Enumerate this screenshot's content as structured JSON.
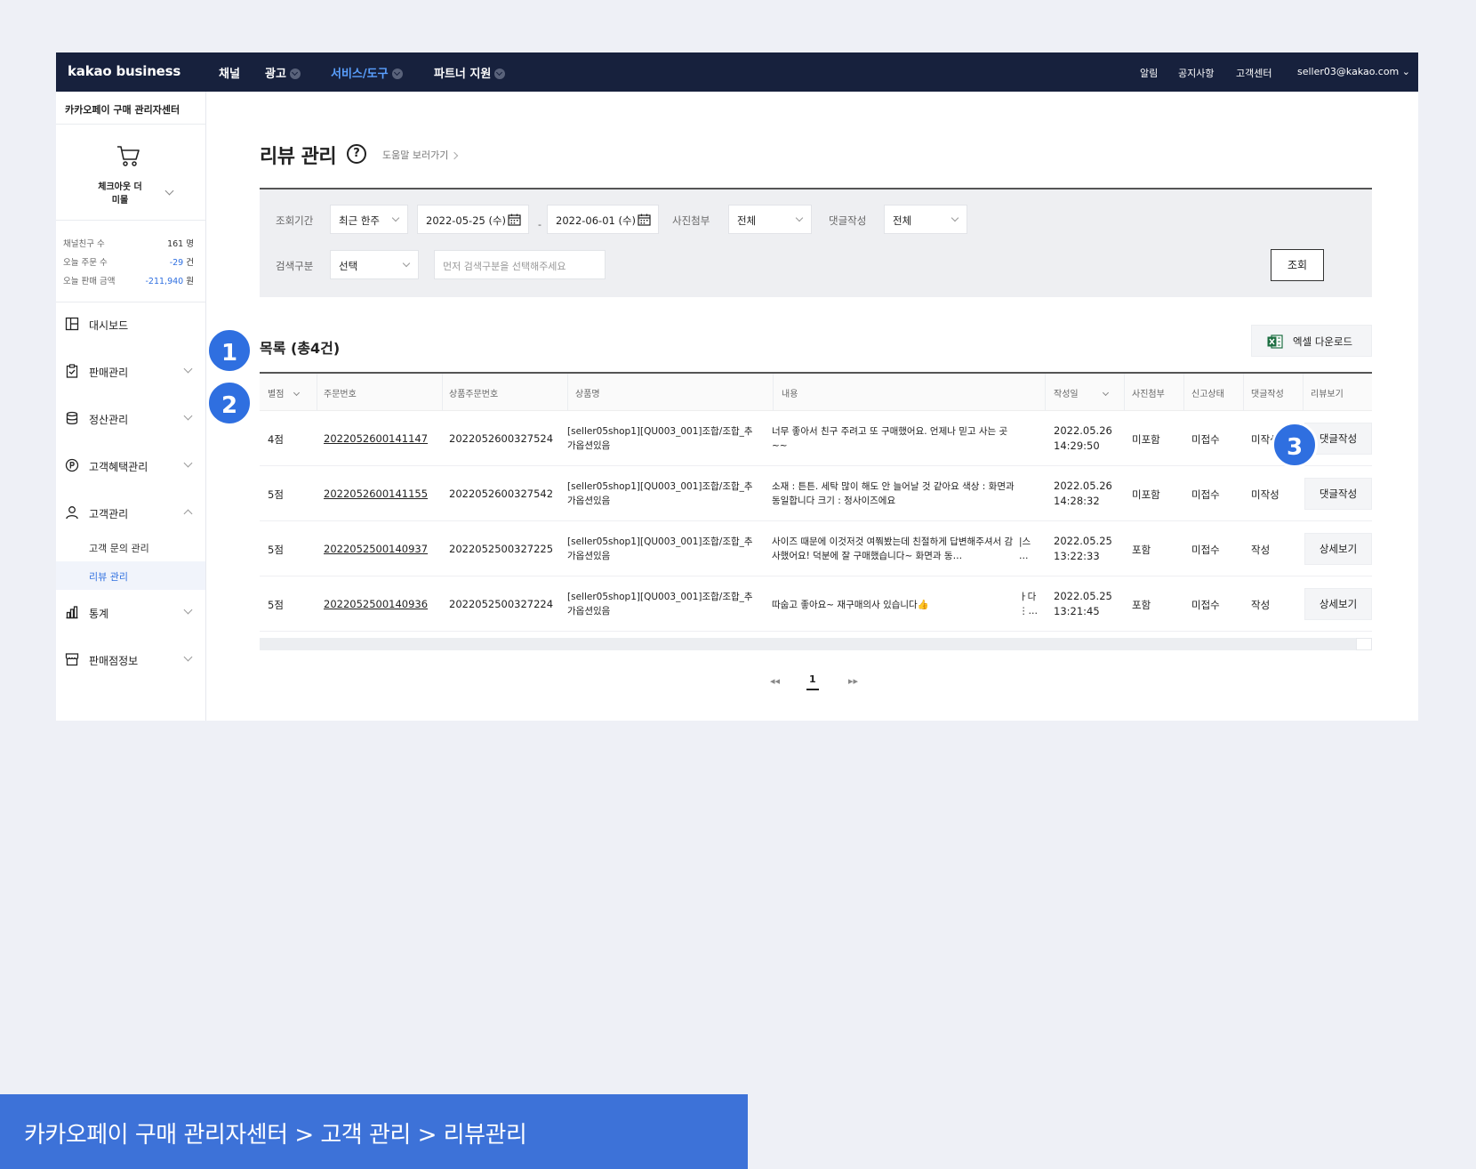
{
  "topnav": {
    "logo": "kakao business",
    "menu": [
      {
        "label": "채널"
      },
      {
        "label": "광고"
      },
      {
        "label": "서비스/도구"
      },
      {
        "label": "파트너 지원"
      }
    ],
    "utils": [
      "알림",
      "공지사항",
      "고객센터",
      "seller03@kakao.com ⌄"
    ]
  },
  "sidebar": {
    "store_title": "카카오페이 구매 관리자센터",
    "shop_name": "체크아웃 더미몰",
    "stats": [
      {
        "label": "채널친구 수",
        "value": "161",
        "unit": "명"
      },
      {
        "label": "오늘 주문 수",
        "value": "-29",
        "unit": "건"
      },
      {
        "label": "오늘 판매 금액",
        "value": "-211,940",
        "unit": "원"
      }
    ],
    "nav": [
      {
        "label": "대시보드"
      },
      {
        "label": "판매관리"
      },
      {
        "label": "정산관리"
      },
      {
        "label": "고객혜택관리"
      },
      {
        "label": "고객관리"
      },
      {
        "label": "통계"
      },
      {
        "label": "판매점정보"
      }
    ],
    "sub": [
      {
        "label": "고객 문의 관리"
      },
      {
        "label": "리뷰 관리"
      }
    ]
  },
  "page": {
    "title": "리뷰 관리",
    "help_icon_glyph": "?",
    "help_link": "도움말 보러가기"
  },
  "filter": {
    "period_label": "조회기간",
    "period_value": "최근 한주",
    "start_date": "2022-05-25 (수)",
    "date_sep": "-",
    "end_date": "2022-06-01 (수)",
    "photo_label": "사진첨부",
    "photo_value": "전체",
    "reply_label": "댓글작성",
    "reply_value": "전체",
    "search_type_label": "검색구분",
    "search_type_value": "선택",
    "search_placeholder": "먼저 검색구분을 선택해주세요",
    "search_button": "조회"
  },
  "list": {
    "title": "목록 (총4건)",
    "excel_button": "엑셀 다운로드",
    "columns": [
      "별점",
      "주문번호",
      "상품주문번호",
      "상품명",
      "내용",
      "작성일",
      "사진첨부",
      "신고상태",
      "댓글작성",
      "리뷰보기"
    ],
    "rows": [
      {
        "rating": "4점",
        "order_no": "2022052600141147",
        "product_order_no": "2022052600327524",
        "product": "[seller05shop1][QU003_001]조합/조합_추가옵션있음",
        "content": "너무 좋아서 친구 주려고 또 구매했어요. 언제나 믿고 사는 곳~~",
        "date": "2022.05.26",
        "time": "14:29:50",
        "photo": "미포함",
        "report": "미접수",
        "reply": "미작성",
        "action": "댓글작성"
      },
      {
        "rating": "5점",
        "order_no": "2022052600141155",
        "product_order_no": "2022052600327542",
        "product": "[seller05shop1][QU003_001]조합/조합_추가옵션있음",
        "content": "소재 : 튼튼. 세탁 많이 해도 안 늘어날 것 같아요 색상 : 화면과 동일합니다 크기 : 정사이즈에요",
        "date": "2022.05.26",
        "time": "14:28:32",
        "photo": "미포함",
        "report": "미접수",
        "reply": "미작성",
        "action": "댓글작성"
      },
      {
        "rating": "5점",
        "order_no": "2022052500140937",
        "product_order_no": "2022052500327225",
        "product": "[seller05shop1][QU003_001]조합/조합_추가옵션있음",
        "content": "사이즈 때문에 이것저것 여쭤봤는데 친절하게 답변해주셔서 감사했어요! 덕분에 잘 구매했습니다~ 화면과 동…",
        "overflow": "|스\n…",
        "date": "2022.05.25",
        "time": "13:22:33",
        "photo": "포함",
        "report": "미접수",
        "reply": "작성",
        "action": "상세보기"
      },
      {
        "rating": "5점",
        "order_no": "2022052500140936",
        "product_order_no": "2022052500327224",
        "product": "[seller05shop1][QU003_001]조합/조합_추가옵션있음",
        "content": "따숩고 좋아요~ 재구매의사 있습니다👍",
        "overflow": "ㅏ다\n⋮…",
        "date": "2022.05.25",
        "time": "13:21:45",
        "photo": "포함",
        "report": "미접수",
        "reply": "작성",
        "action": "상세보기"
      }
    ]
  },
  "pagination": {
    "first": "◂◂",
    "current": "1",
    "last": "▸▸"
  },
  "markers": [
    "1",
    "2",
    "3"
  ],
  "caption": "카카오페이 구매 관리자센터 > 고객 관리 > 리뷰관리",
  "colors": {
    "nav_bg": "#17213d",
    "accent": "#2f6fe0",
    "caption_bg": "#3d72d8"
  }
}
